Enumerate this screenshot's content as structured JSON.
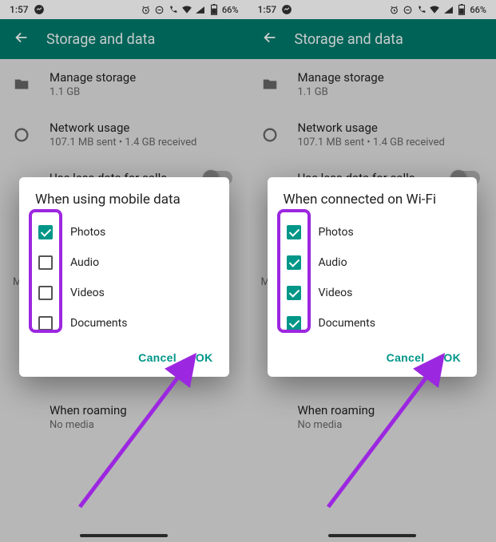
{
  "status": {
    "time": "1:57",
    "battery": "66%"
  },
  "appbar": {
    "title": "Storage and data"
  },
  "settings": {
    "manage_storage": {
      "title": "Manage storage",
      "subtitle": "1.1 GB"
    },
    "network_usage": {
      "title": "Network usage",
      "subtitle": "107.1 MB sent • 1.4 GB received"
    },
    "use_less_data": {
      "title": "Use less data for calls"
    },
    "when_roaming": {
      "title": "When roaming",
      "subtitle": "No media"
    }
  },
  "dialogs": [
    {
      "title": "When using mobile data",
      "options": [
        {
          "label": "Photos",
          "checked": true
        },
        {
          "label": "Audio",
          "checked": false
        },
        {
          "label": "Videos",
          "checked": false
        },
        {
          "label": "Documents",
          "checked": false
        }
      ]
    },
    {
      "title": "When connected on Wi-Fi",
      "options": [
        {
          "label": "Photos",
          "checked": true
        },
        {
          "label": "Audio",
          "checked": true
        },
        {
          "label": "Videos",
          "checked": true
        },
        {
          "label": "Documents",
          "checked": true
        }
      ]
    }
  ],
  "buttons": {
    "cancel": "Cancel",
    "ok": "OK"
  },
  "section_hint": "M"
}
